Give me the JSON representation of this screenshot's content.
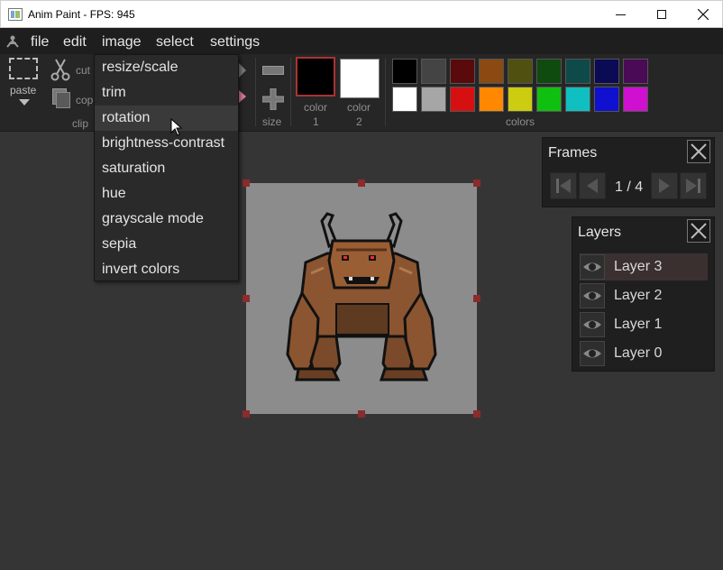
{
  "window": {
    "title": "Anim Paint - FPS: 945"
  },
  "menubar": {
    "items": [
      "file",
      "edit",
      "image",
      "select",
      "settings"
    ]
  },
  "toolbar": {
    "paste_label": "paste",
    "cut_label": "cut",
    "copy_label": "cop",
    "clipboard_group": "clip",
    "size_label": "size",
    "color1_label": "color",
    "color1_num": "1",
    "color2_label": "color",
    "color2_num": "2",
    "colors_label": "colors",
    "color1_value": "#000000",
    "color2_value": "#ffffff",
    "palette_row1": [
      "#000000",
      "#444444",
      "#5a0a0a",
      "#8a4a12",
      "#505010",
      "#0f4a0f",
      "#0f4a4a",
      "#0a0a55",
      "#4a0a55"
    ],
    "palette_row2": [
      "#ffffff",
      "#a6a6a6",
      "#d61010",
      "#ff8800",
      "#cccc10",
      "#10c010",
      "#10c0c0",
      "#1010d0",
      "#d010d0"
    ]
  },
  "image_menu": {
    "items": [
      "resize/scale",
      "trim",
      "rotation",
      "brightness-contrast",
      "saturation",
      "hue",
      "grayscale mode",
      "sepia",
      "invert colors"
    ],
    "hovered_index": 2
  },
  "frames_panel": {
    "title": "Frames",
    "counter": "1 / 4"
  },
  "layers_panel": {
    "title": "Layers",
    "layers": [
      "Layer 3",
      "Layer 2",
      "Layer 1",
      "Layer 0"
    ],
    "active_index": 0
  }
}
